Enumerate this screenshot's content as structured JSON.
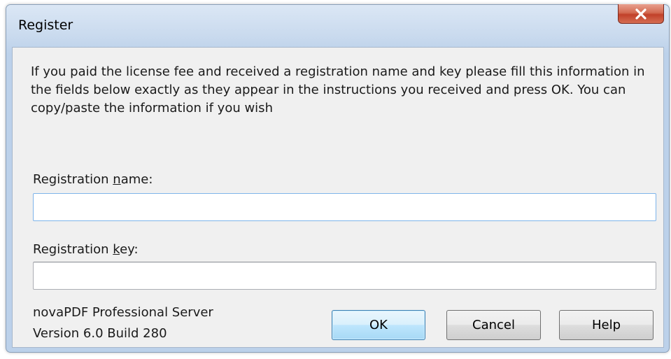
{
  "window": {
    "title": "Register"
  },
  "instructions": "If you paid the license fee and received a registration name and key please fill this information in the fields below exactly as they appear in the instructions you received and press OK. You can copy/paste the information if you wish",
  "fields": {
    "name": {
      "label_prefix": "Registration ",
      "label_accel": "n",
      "label_suffix": "ame:",
      "value": ""
    },
    "key": {
      "label_prefix": "Registration ",
      "label_accel": "k",
      "label_suffix": "ey:",
      "value": ""
    }
  },
  "product": {
    "name": "novaPDF Professional Server",
    "version": "Version 6.0 Build 280"
  },
  "buttons": {
    "ok": "OK",
    "cancel": "Cancel",
    "help": "Help"
  },
  "icons": {
    "close": "close-icon"
  },
  "colors": {
    "close_button": "#c94a31",
    "default_button_border": "#3c7fb1",
    "focus_border": "#7eb4ea"
  }
}
